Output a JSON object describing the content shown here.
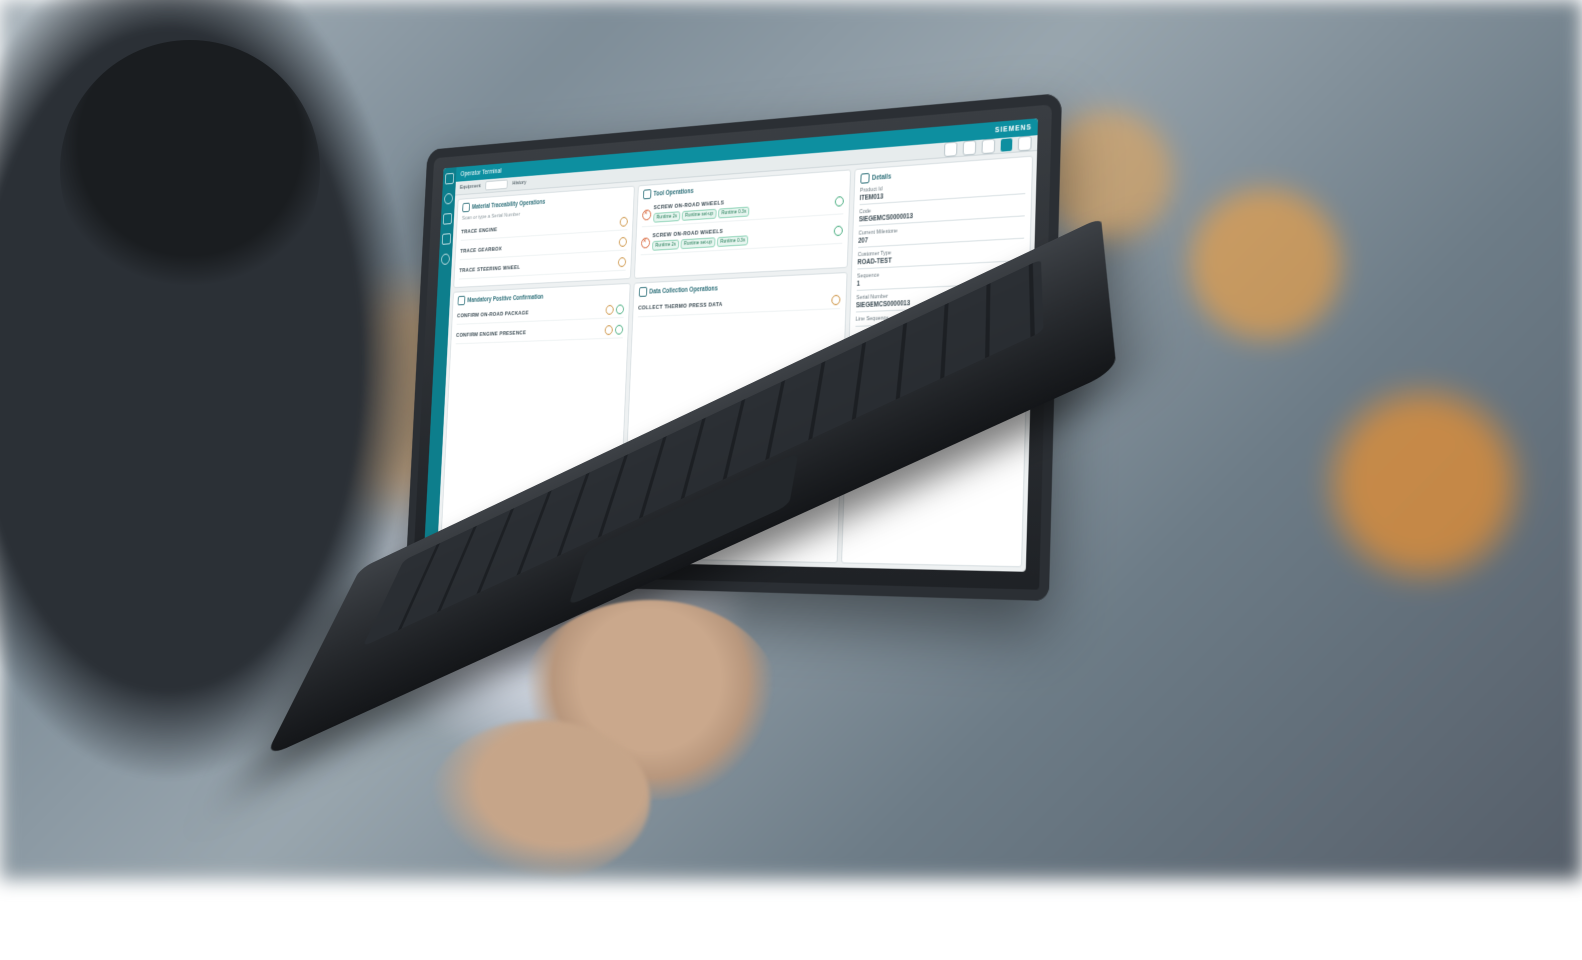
{
  "app": {
    "title": "Operator Terminal",
    "brand": "SIEMENS",
    "subbar": {
      "equipment_label": "Equipment",
      "history_label": "History"
    }
  },
  "panels": {
    "material": {
      "title": "Material Traceability Operations",
      "hint": "Scan or type a Serial Number",
      "rows": [
        "TRACE ENGINE",
        "TRACE GEARBOX",
        "TRACE STEERING WHEEL"
      ]
    },
    "tool": {
      "title": "Tool Operations",
      "items": [
        {
          "name": "SCREW ON-ROAD WHEELS",
          "tags": [
            "Runtime 2s",
            "Runtime set-up",
            "Runtime 0.3s"
          ]
        },
        {
          "name": "SCREW ON-ROAD WHEELS",
          "tags": [
            "Runtime 2s",
            "Runtime set-up",
            "Runtime 0.3s"
          ]
        }
      ]
    },
    "confirm": {
      "title": "Mandatory Positive Confirmation",
      "rows": [
        "CONFIRM ON-ROAD PACKAGE",
        "CONFIRM ENGINE PRESENCE"
      ]
    },
    "datacollect": {
      "title": "Data Collection Operations",
      "rows": [
        "COLLECT THERMO PRESS DATA"
      ]
    },
    "details": {
      "title": "Details",
      "fields": [
        {
          "k": "Product Id",
          "v": "ITEM013"
        },
        {
          "k": "Code",
          "v": "SIEGEMCS0000013"
        },
        {
          "k": "Current Milestone",
          "v": "207"
        },
        {
          "k": "Customer Type",
          "v": "ROAD-TEST"
        },
        {
          "k": "Sequence",
          "v": "1"
        },
        {
          "k": "Serial Number",
          "v": "SIEGEMCS0000013"
        },
        {
          "k": "Line Sequence",
          "v": ""
        }
      ]
    }
  }
}
